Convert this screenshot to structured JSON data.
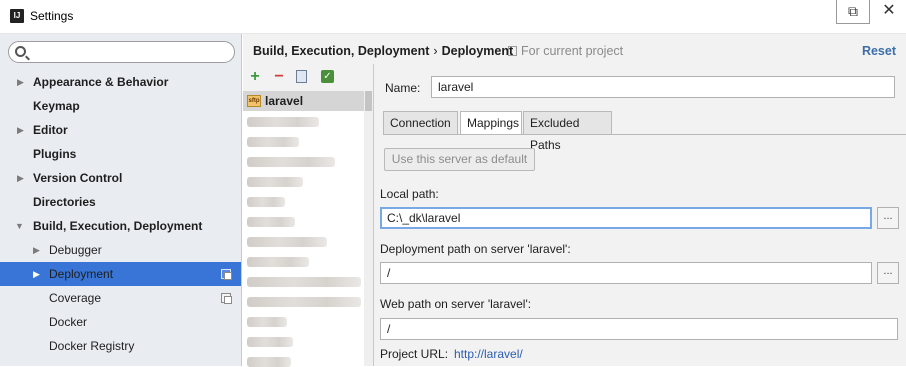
{
  "window": {
    "title": "Settings",
    "icon": "intellij-app-icon",
    "restore_glyph": "⧉",
    "close_glyph": "✕"
  },
  "sidebar": {
    "search": {
      "value": "",
      "placeholder": ""
    },
    "items": [
      {
        "label": "Appearance & Behavior",
        "arrow": "▶",
        "bold": true
      },
      {
        "label": "Keymap",
        "arrow": "",
        "bold": true
      },
      {
        "label": "Editor",
        "arrow": "▶",
        "bold": true
      },
      {
        "label": "Plugins",
        "arrow": "",
        "bold": true
      },
      {
        "label": "Version Control",
        "arrow": "▶",
        "bold": true
      },
      {
        "label": "Directories",
        "arrow": "",
        "bold": true
      },
      {
        "label": "Build, Execution, Deployment",
        "arrow": "▼",
        "bold": true
      },
      {
        "label": "Debugger",
        "arrow": "▶",
        "bold": false
      },
      {
        "label": "Deployment",
        "arrow": "▶",
        "bold": false,
        "selected": true,
        "project_icon": true
      },
      {
        "label": "Coverage",
        "arrow": "",
        "bold": false,
        "project_icon": true
      },
      {
        "label": "Docker",
        "arrow": "",
        "bold": false
      },
      {
        "label": "Docker Registry",
        "arrow": "",
        "bold": false
      }
    ]
  },
  "header": {
    "breadcrumb_parent": "Build, Execution, Deployment",
    "breadcrumb_sep": "›",
    "breadcrumb_current": "Deployment",
    "scope": "For current project",
    "reset_label": "Reset"
  },
  "servers": {
    "toolbar": {
      "add": "+",
      "remove": "−",
      "check": "✓"
    },
    "selected_icon_text": "sftp",
    "selected_name": "laravel"
  },
  "form": {
    "name_label": "Name:",
    "name_value": "laravel",
    "tabs": [
      "Connection",
      "Mappings",
      "Excluded Paths"
    ],
    "active_tab": "Mappings",
    "default_button": "Use this server as default",
    "local_path_label": "Local path:",
    "local_path_value": "C:\\_dk\\laravel",
    "deployment_path_label": "Deployment path on server 'laravel':",
    "deployment_path_value": "/",
    "web_path_label": "Web path on server 'laravel':",
    "web_path_value": "/",
    "project_url_label": "Project URL:",
    "project_url_value": "http://laravel/",
    "browse_glyph": "..."
  },
  "colors": {
    "selection": "#3875d7",
    "sidebar_bg": "#e9edf2",
    "link": "#2a5db0",
    "add": "#3c9a3c",
    "remove": "#d23c3c"
  }
}
